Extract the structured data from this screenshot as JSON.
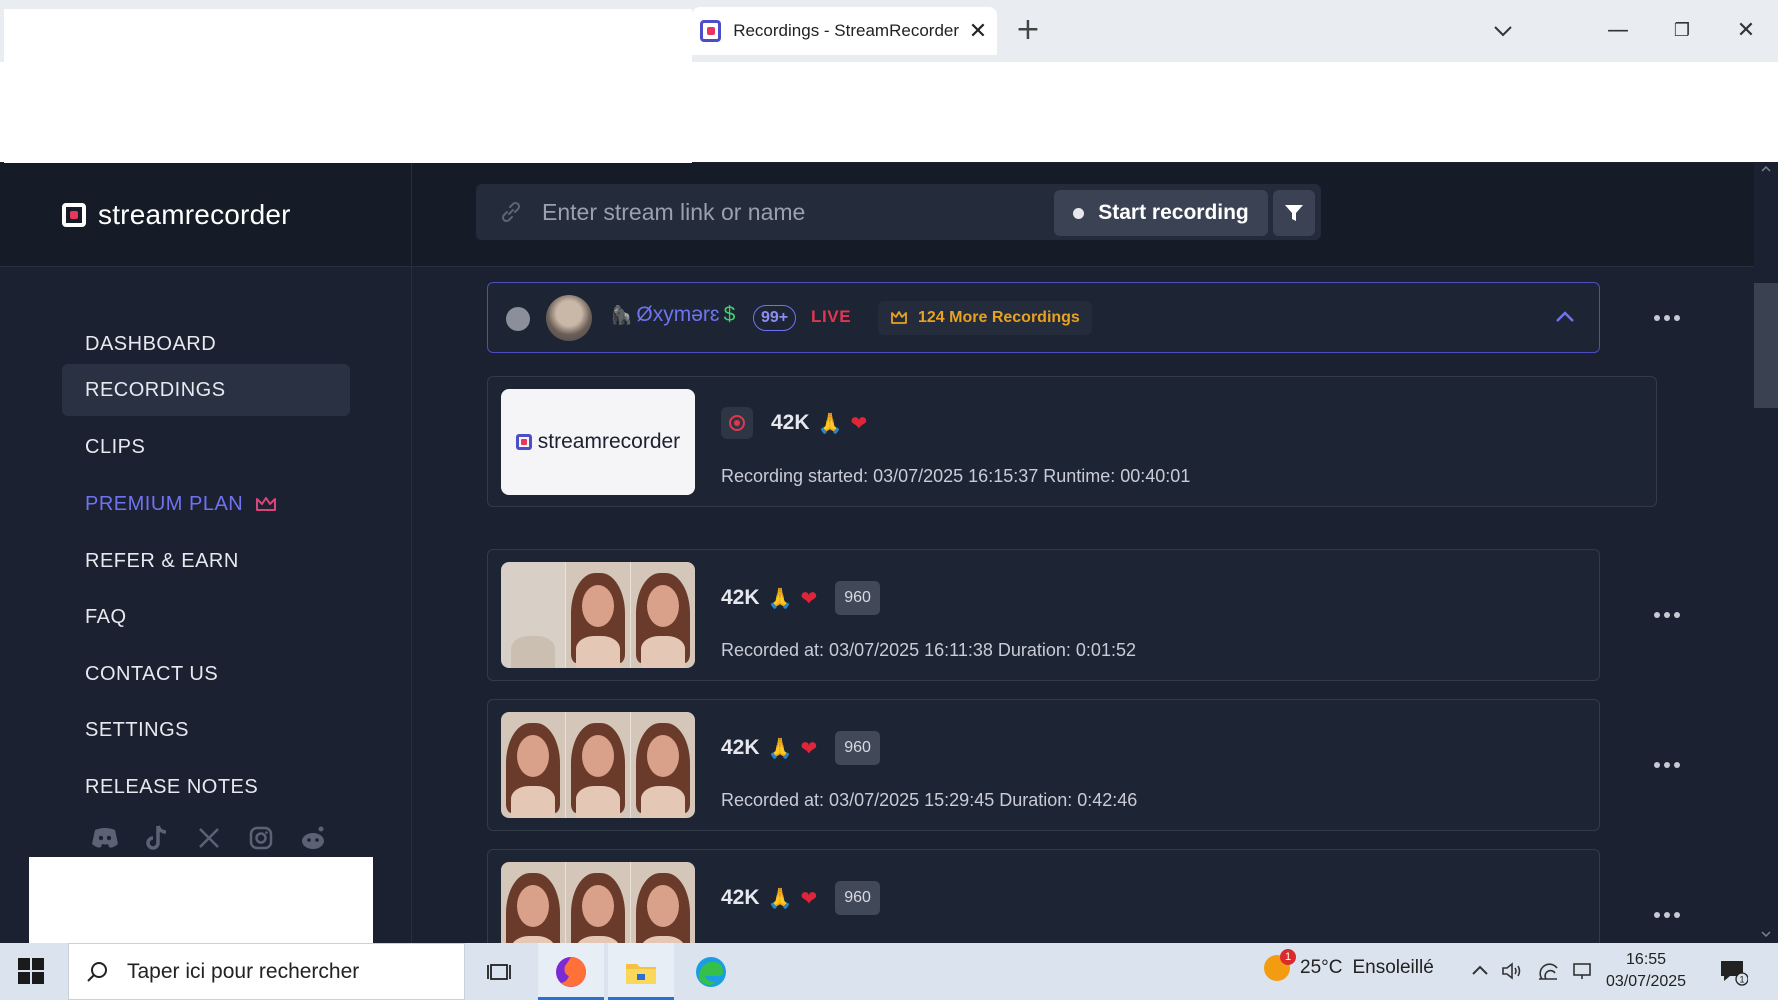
{
  "browser": {
    "tab_title": "Recordings - StreamRecorder",
    "tab_close": "✕",
    "new_tab": "+",
    "minimize": "—",
    "maximize": "❐",
    "close": "✕"
  },
  "app": {
    "logo_text": "streamrecorder",
    "search": {
      "placeholder": "Enter stream link or name",
      "value": ""
    },
    "start_recording_label": "Start recording"
  },
  "sidebar": {
    "items": [
      {
        "label": "DASHBOARD",
        "active": false
      },
      {
        "label": "RECORDINGS",
        "active": true
      },
      {
        "label": "CLIPS",
        "active": false
      },
      {
        "label": "PREMIUM PLAN",
        "active": false
      },
      {
        "label": "REFER & EARN",
        "active": false
      },
      {
        "label": "FAQ",
        "active": false
      },
      {
        "label": "CONTACT US",
        "active": false
      },
      {
        "label": "SETTINGS",
        "active": false
      },
      {
        "label": "RELEASE NOTES",
        "active": false
      }
    ],
    "social_icons": [
      "discord-icon",
      "tiktok-icon",
      "x-icon",
      "instagram-icon",
      "reddit-icon"
    ]
  },
  "channel": {
    "name": "Øxymərɛ",
    "name_prefix_emoji": "🦍",
    "name_suffix": "$",
    "count_badge": "99+",
    "live_label": "LIVE",
    "more_recordings": "124 More Recordings"
  },
  "live_recording": {
    "thumb_logo_text": "streamrecorder",
    "title": "42K",
    "emojis": [
      "🙏",
      "❤"
    ],
    "meta": "Recording started: 03/07/2025 16:15:37 Runtime: 00:40:01"
  },
  "recordings": [
    {
      "title": "42K",
      "emojis": [
        "🙏",
        "❤"
      ],
      "resolution": "960",
      "meta": "Recorded at: 03/07/2025 16:11:38 Duration: 0:01:52"
    },
    {
      "title": "42K",
      "emojis": [
        "🙏",
        "❤"
      ],
      "resolution": "960",
      "meta": "Recorded at: 03/07/2025 15:29:45 Duration: 0:42:46"
    },
    {
      "title": "42K",
      "emojis": [
        "🙏",
        "❤"
      ],
      "resolution": "960",
      "meta": ""
    }
  ],
  "taskbar": {
    "search_placeholder": "Taper ici pour rechercher",
    "weather_temp": "25°C",
    "weather_text": "Ensoleillé",
    "weather_badge": "1",
    "time": "16:55",
    "date": "03/07/2025",
    "notification_count": "1"
  },
  "colors": {
    "accent": "#6f73f0",
    "live": "#e0374e",
    "premium_more": "#e7a21f",
    "background": "#1b2130"
  }
}
